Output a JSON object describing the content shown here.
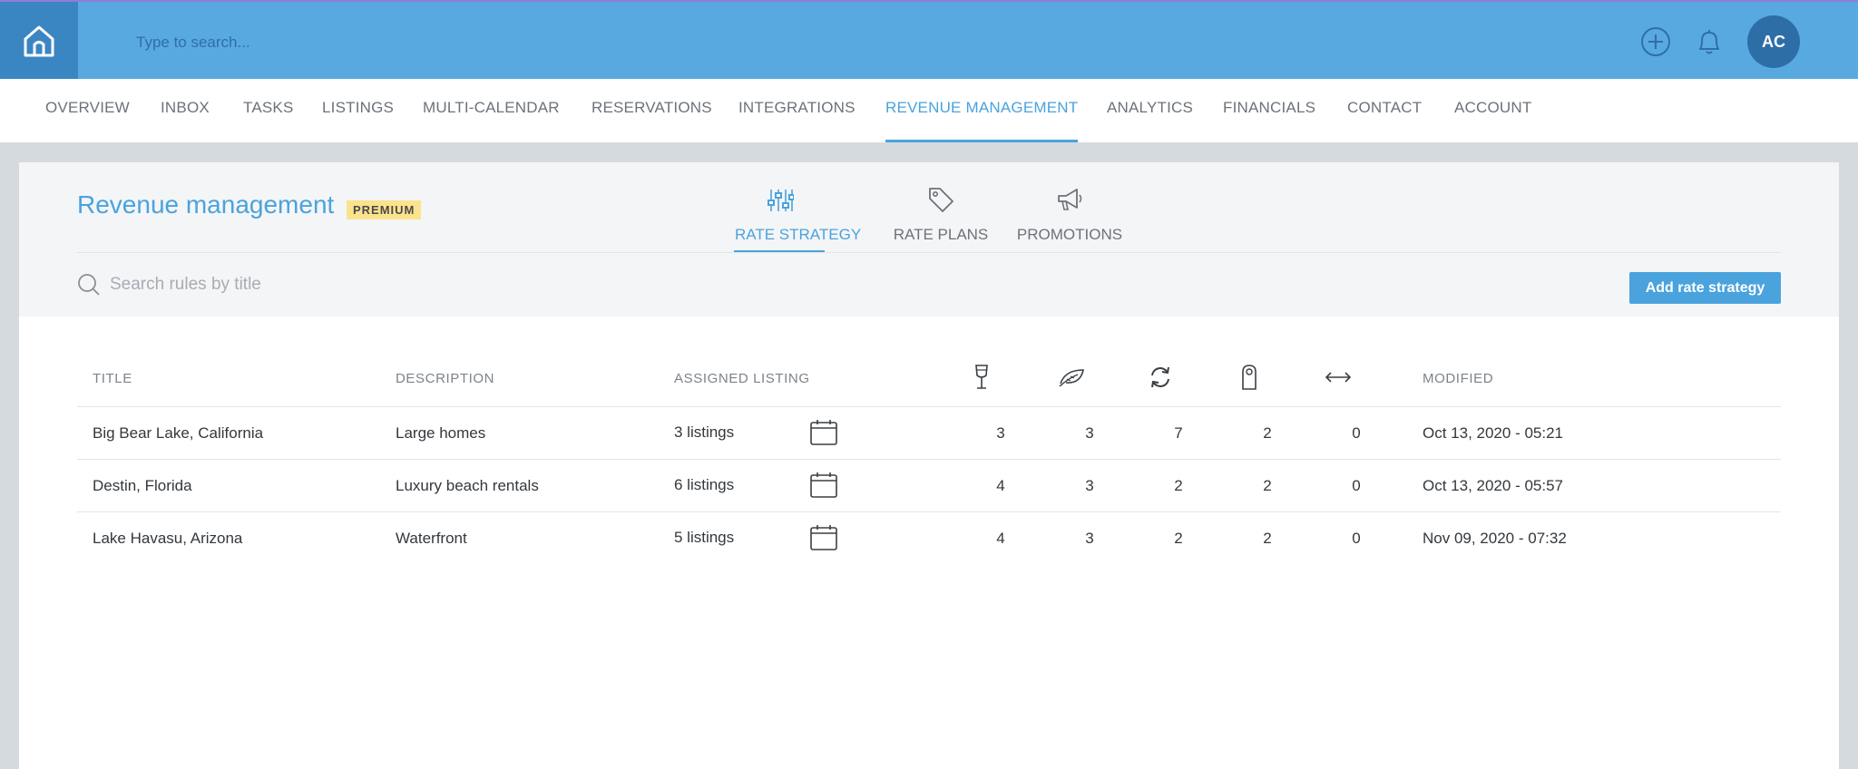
{
  "topbar": {
    "search_placeholder": "Type to search...",
    "avatar_initials": "AC"
  },
  "nav": [
    {
      "label": "OVERVIEW"
    },
    {
      "label": "INBOX"
    },
    {
      "label": "TASKS"
    },
    {
      "label": "LISTINGS"
    },
    {
      "label": "MULTI-CALENDAR"
    },
    {
      "label": "RESERVATIONS"
    },
    {
      "label": "INTEGRATIONS"
    },
    {
      "label": "REVENUE MANAGEMENT",
      "active": true
    },
    {
      "label": "ANALYTICS"
    },
    {
      "label": "FINANCIALS"
    },
    {
      "label": "CONTACT"
    },
    {
      "label": "ACCOUNT"
    }
  ],
  "page": {
    "title": "Revenue management",
    "badge": "PREMIUM",
    "search_placeholder": "Search rules by title",
    "add_button": "Add rate strategy"
  },
  "subtabs": [
    {
      "label": "RATE STRATEGY",
      "icon": "sliders-icon",
      "active": true
    },
    {
      "label": "RATE PLANS",
      "icon": "price-tag-icon"
    },
    {
      "label": "PROMOTIONS",
      "icon": "megaphone-icon"
    }
  ],
  "table": {
    "headers": {
      "title": "TITLE",
      "description": "DESCRIPTION",
      "assigned": "ASSIGNED LISTING",
      "modified": "MODIFIED"
    },
    "icon_columns": [
      "wine-glass-icon",
      "leaf-icon",
      "refresh-icon",
      "door-hanger-icon",
      "arrows-horizontal-icon"
    ],
    "rows": [
      {
        "title": "Big Bear Lake, California",
        "description": "Large homes",
        "listings": "3 listings",
        "c1": "3",
        "c2": "3",
        "c3": "7",
        "c4": "2",
        "c5": "0",
        "modified": "Oct 13, 2020 - 05:21"
      },
      {
        "title": "Destin, Florida",
        "description": "Luxury beach rentals",
        "listings": "6 listings",
        "c1": "4",
        "c2": "3",
        "c3": "2",
        "c4": "2",
        "c5": "0",
        "modified": "Oct 13, 2020 - 05:57"
      },
      {
        "title": "Lake Havasu, Arizona",
        "description": "Waterfront",
        "listings": "5 listings",
        "c1": "4",
        "c2": "3",
        "c3": "2",
        "c4": "2",
        "c5": "0",
        "modified": "Nov 09, 2020 - 07:32"
      }
    ]
  }
}
